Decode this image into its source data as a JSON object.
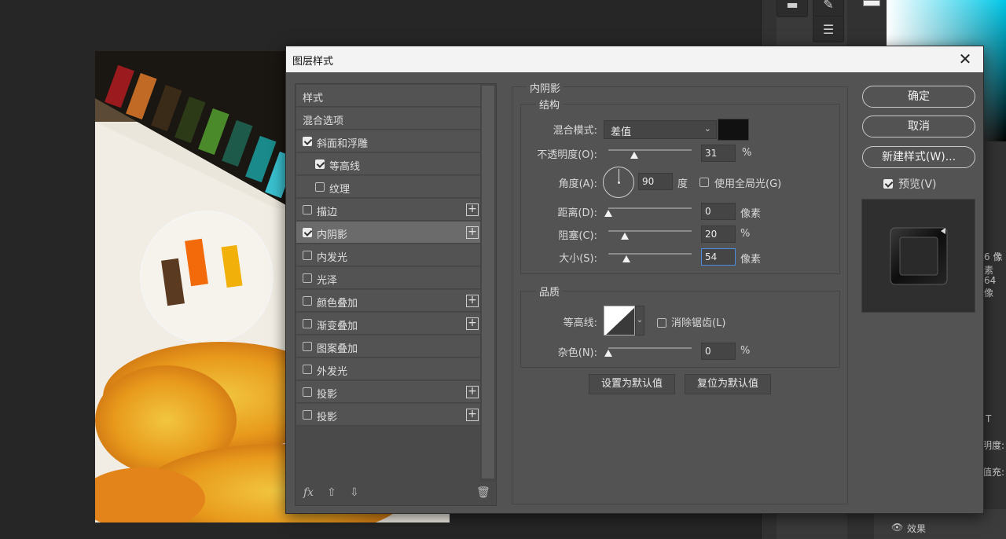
{
  "dialog": {
    "title": "图层样式",
    "close_glyph": "✕"
  },
  "styles_list": {
    "items": [
      {
        "label": "样式",
        "has_checkbox": false,
        "checked": false,
        "has_plus": false,
        "selected": false,
        "indent": false
      },
      {
        "label": "混合选项",
        "has_checkbox": false,
        "checked": false,
        "has_plus": false,
        "selected": false,
        "indent": false
      },
      {
        "label": "斜面和浮雕",
        "has_checkbox": true,
        "checked": true,
        "has_plus": false,
        "selected": false,
        "indent": false
      },
      {
        "label": "等高线",
        "has_checkbox": true,
        "checked": true,
        "has_plus": false,
        "selected": false,
        "indent": true
      },
      {
        "label": "纹理",
        "has_checkbox": true,
        "checked": false,
        "has_plus": false,
        "selected": false,
        "indent": true
      },
      {
        "label": "描边",
        "has_checkbox": true,
        "checked": false,
        "has_plus": true,
        "selected": false,
        "indent": false
      },
      {
        "label": "内阴影",
        "has_checkbox": true,
        "checked": true,
        "has_plus": true,
        "selected": true,
        "indent": false
      },
      {
        "label": "内发光",
        "has_checkbox": true,
        "checked": false,
        "has_plus": false,
        "selected": false,
        "indent": false
      },
      {
        "label": "光泽",
        "has_checkbox": true,
        "checked": false,
        "has_plus": false,
        "selected": false,
        "indent": false
      },
      {
        "label": "颜色叠加",
        "has_checkbox": true,
        "checked": false,
        "has_plus": true,
        "selected": false,
        "indent": false
      },
      {
        "label": "渐变叠加",
        "has_checkbox": true,
        "checked": false,
        "has_plus": true,
        "selected": false,
        "indent": false
      },
      {
        "label": "图案叠加",
        "has_checkbox": true,
        "checked": false,
        "has_plus": false,
        "selected": false,
        "indent": false
      },
      {
        "label": "外发光",
        "has_checkbox": true,
        "checked": false,
        "has_plus": false,
        "selected": false,
        "indent": false
      },
      {
        "label": "投影",
        "has_checkbox": true,
        "checked": false,
        "has_plus": true,
        "selected": false,
        "indent": false
      },
      {
        "label": "投影",
        "has_checkbox": true,
        "checked": false,
        "has_plus": true,
        "selected": false,
        "indent": false
      }
    ],
    "footer": {
      "fx": "fx",
      "up_glyph": "⇧",
      "down_glyph": "⇩",
      "trash_glyph": "🗑"
    }
  },
  "inner_shadow": {
    "section_title": "内阴影",
    "structure": {
      "title": "结构",
      "blend_mode_label": "混合模式:",
      "blend_mode_value": "差值",
      "blend_color": "#111111",
      "opacity_label": "不透明度(O):",
      "opacity_value": "31",
      "opacity_unit": "%",
      "opacity_fraction": 0.31,
      "angle_label": "角度(A):",
      "angle_value": "90",
      "angle_unit": "度",
      "use_global_light_label": "使用全局光(G)",
      "use_global_light_checked": false,
      "distance_label": "距离(D):",
      "distance_value": "0",
      "distance_unit": "像素",
      "distance_fraction": 0.0,
      "choke_label": "阻塞(C):",
      "choke_value": "20",
      "choke_unit": "%",
      "choke_fraction": 0.2,
      "size_label": "大小(S):",
      "size_value": "54",
      "size_unit": "像素",
      "size_fraction": 0.22
    },
    "quality": {
      "title": "品质",
      "contour_label": "等高线:",
      "anti_alias_label": "消除锯齿(L)",
      "anti_alias_checked": false,
      "noise_label": "杂色(N):",
      "noise_value": "0",
      "noise_unit": "%",
      "noise_fraction": 0.0
    },
    "set_default_label": "设置为默认值",
    "reset_default_label": "复位为默认值"
  },
  "actions": {
    "ok_label": "确定",
    "cancel_label": "取消",
    "new_style_label": "新建样式(W)...",
    "preview_label": "预览(V)",
    "preview_checked": true
  },
  "side_panel": {
    "pixel_a": "6 像素",
    "pixel_b": "64 像",
    "type_tool": "T",
    "opacity_short": "明度:",
    "fill_short": "值充:",
    "effects_label": "效果"
  }
}
